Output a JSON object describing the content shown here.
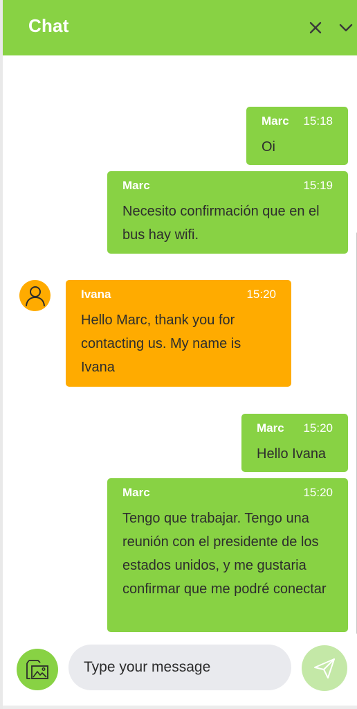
{
  "header": {
    "title": "Chat",
    "close_icon": "close-icon",
    "collapse_icon": "chevron-down-icon"
  },
  "messages": [
    {
      "author": "Marc",
      "time": "15:18",
      "text": "Oi",
      "direction": "outgoing"
    },
    {
      "author": "Marc",
      "time": "15:19",
      "text": "Necesito confirmación que en el bus hay wifi.",
      "direction": "outgoing"
    },
    {
      "author": "Ivana",
      "time": "15:20",
      "text": "Hello Marc, thank you for contacting us. My name is Ivana",
      "direction": "incoming",
      "avatar_icon": "user-icon"
    },
    {
      "author": "Marc",
      "time": "15:20",
      "text": "Hello Ivana",
      "direction": "outgoing"
    },
    {
      "author": "Marc",
      "time": "15:20",
      "text": "Tengo que trabajar. Tengo una reunión con el presidente de los estados unidos, y me gustaria confirmar que me podré conectar",
      "direction": "outgoing"
    }
  ],
  "composer": {
    "placeholder": "Type your message",
    "value": "",
    "attach_icon": "image-attach-icon",
    "send_icon": "send-icon"
  },
  "colors": {
    "brand_green": "#88d244",
    "agent_orange": "#ffab00",
    "input_bg": "#e9eaee",
    "send_disabled": "#c4e8a7"
  }
}
